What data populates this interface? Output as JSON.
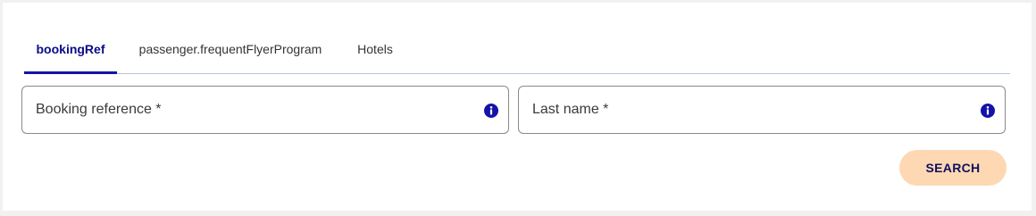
{
  "tabs": [
    {
      "label": "bookingRef",
      "active": true
    },
    {
      "label": "passenger.frequentFlyerProgram",
      "active": false
    },
    {
      "label": "Hotels",
      "active": false
    }
  ],
  "form": {
    "booking_reference": {
      "placeholder": "Booking reference *",
      "value": ""
    },
    "last_name": {
      "placeholder": "Last name *",
      "value": ""
    }
  },
  "search_button": {
    "label": "SEARCH"
  },
  "icons": {
    "field_info": "info-icon"
  },
  "colors": {
    "accent": "#1313a8",
    "button_bg": "#fdd8b3",
    "button_text": "#10105e"
  }
}
